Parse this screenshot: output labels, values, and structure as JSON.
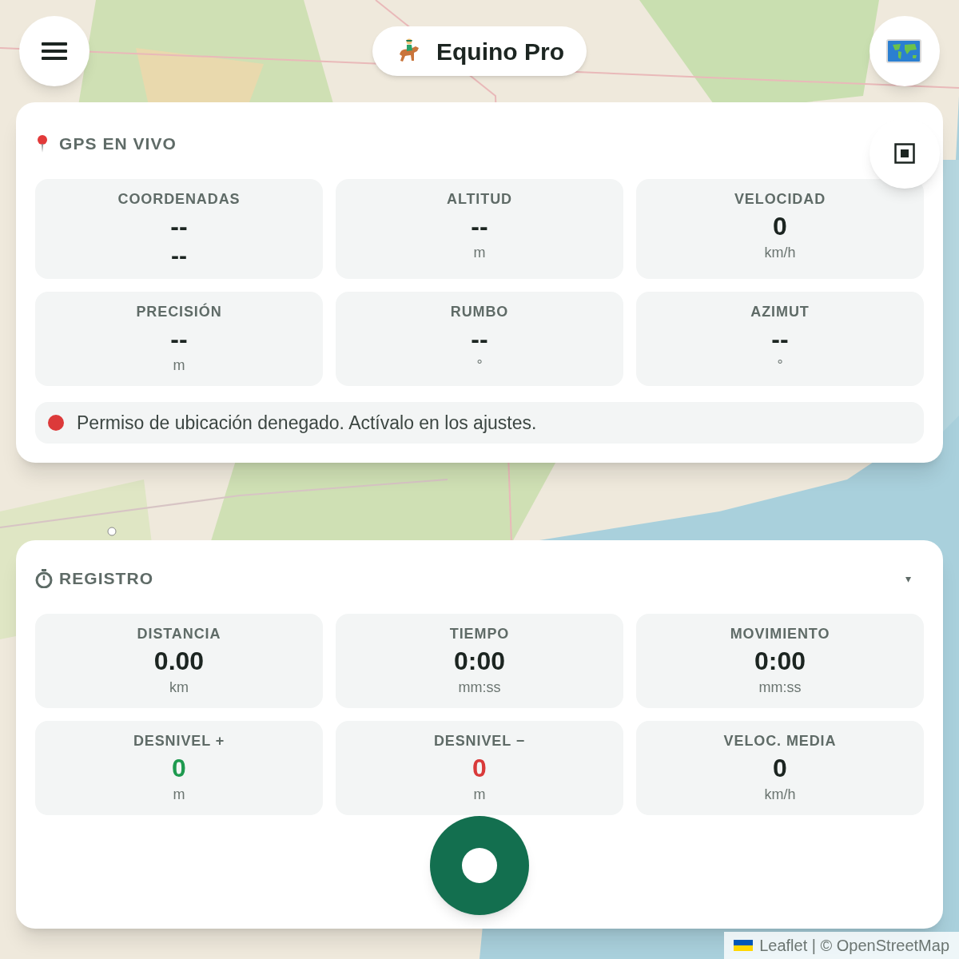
{
  "header": {
    "title": "Equino Pro"
  },
  "gps_panel": {
    "title": "GPS EN VIVO",
    "stats": [
      {
        "kind": "coords",
        "label": "COORDENADAS",
        "value": "--",
        "sub": "--"
      },
      {
        "kind": "measure",
        "label": "ALTITUD",
        "value": "--",
        "sub": "m"
      },
      {
        "kind": "measure",
        "label": "VELOCIDAD",
        "value": "0",
        "sub": "km/h"
      },
      {
        "kind": "measure",
        "label": "PRECISIÓN",
        "value": "--",
        "sub": "m"
      },
      {
        "kind": "measure",
        "label": "RUMBO",
        "value": "--",
        "sub": "°"
      },
      {
        "kind": "measure",
        "label": "AZIMUT",
        "value": "--",
        "sub": "°"
      }
    ],
    "message": {
      "color": "#dc3a3a",
      "text": "Permiso de ubicación denegado. Actívalo en los ajustes."
    }
  },
  "record_panel": {
    "title": "REGISTRO",
    "caret": "▾",
    "stats": [
      {
        "label": "DISTANCIA",
        "value": "0.00",
        "sub": "km",
        "color": "#1c2521"
      },
      {
        "label": "TIEMPO",
        "value": "0:00",
        "sub": "mm:ss",
        "color": "#1c2521"
      },
      {
        "label": "MOVIMIENTO",
        "value": "0:00",
        "sub": "mm:ss",
        "color": "#1c2521"
      },
      {
        "label": "DESNIVEL +",
        "value": "0",
        "sub": "m",
        "color": "#1e9a4f"
      },
      {
        "label": "DESNIVEL −",
        "value": "0",
        "sub": "m",
        "color": "#d93a3a"
      },
      {
        "label": "VELOC. MEDIA",
        "value": "0",
        "sub": "km/h",
        "color": "#1c2521"
      }
    ]
  },
  "attribution": "Leaflet | © OpenStreetMap"
}
